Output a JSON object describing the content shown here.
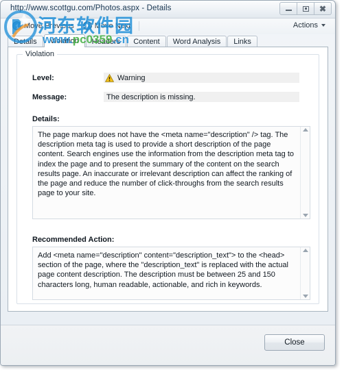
{
  "window": {
    "title": "http://www.scottgu.com/Photos.aspx - Details",
    "controls": {
      "minimize": "minimize-icon",
      "maximize": "maximize-icon",
      "close": "close-icon"
    }
  },
  "toolbar": {
    "move_previous": "Move Previous",
    "move_next": "Move Next",
    "actions": "Actions",
    "prev_icon": "arrow-left-icon",
    "next_icon": "arrow-right-icon",
    "caret_icon": "chevron-down-icon"
  },
  "tabs": [
    {
      "label": "Details",
      "selected": false
    },
    {
      "label": "Violation",
      "selected": true
    },
    {
      "label": "Headers",
      "selected": false
    },
    {
      "label": "Content",
      "selected": false
    },
    {
      "label": "Word Analysis",
      "selected": false
    },
    {
      "label": "Links",
      "selected": false
    }
  ],
  "violation": {
    "group_title": "Violation",
    "level": {
      "label": "Level:",
      "value": "Warning",
      "icon": "warning-triangle-icon",
      "icon_color": "#f3c01b"
    },
    "message": {
      "label": "Message:",
      "value": "The description is missing."
    },
    "details": {
      "label": "Details:",
      "text": "The page markup does not have the <meta name=\"description\" /> tag. The description meta tag is used to provide a short description of the page content. Search engines use the information from the description meta tag to index the page and to present the summary of the content on the search results page. An inaccurate or irrelevant description can affect the ranking of the page and reduce the number of click-throughs from the search results page to your site."
    },
    "recommended_action": {
      "label": "Recommended Action:",
      "text": "Add <meta name=\"description\" content=\"description_text\"> to the <head> section of the page, where the \"description_text\" is replaced with the actual page content description. The description must be between 25 and 150 characters long, human readable, actionable, and rich in keywords."
    }
  },
  "footer": {
    "close_label": "Close"
  },
  "watermark": {
    "chinese": "河东软件园",
    "url_blue": "www.",
    "url_green": "pc0359",
    "url_blue2": ".cn"
  },
  "colors": {
    "warning": "#f3c01b",
    "title_text": "#16344f",
    "readonly_field": "#f0f0f0",
    "watermark_blue": "#1f8fd8",
    "watermark_green": "#3fae3f"
  }
}
